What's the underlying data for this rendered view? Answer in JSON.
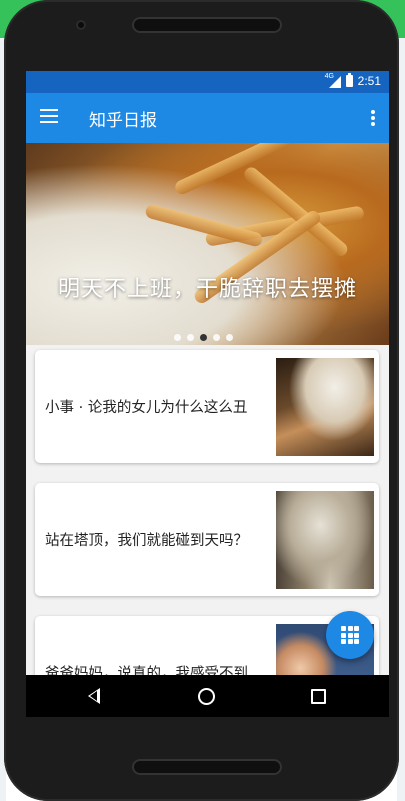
{
  "status_bar": {
    "network": "4G",
    "time": "2:51"
  },
  "app_bar": {
    "title": "知乎日报"
  },
  "banner": {
    "title": "明天不上班，干脆辞职去摆摊",
    "dots_total": 5,
    "active_dot": 2
  },
  "stories": [
    {
      "title": "小事 · 论我的女儿为什么这么丑"
    },
    {
      "title": "站在塔顶，我们就能碰到天吗？"
    },
    {
      "title": "爸爸妈妈，说真的，我感受不到"
    }
  ],
  "colors": {
    "primary": "#1e88e5",
    "status": "#1565c0",
    "accent_bg": "#36c25b"
  },
  "icons": {
    "menu": "menu-icon",
    "more": "more-vert-icon",
    "fab": "grid-apps-icon"
  }
}
